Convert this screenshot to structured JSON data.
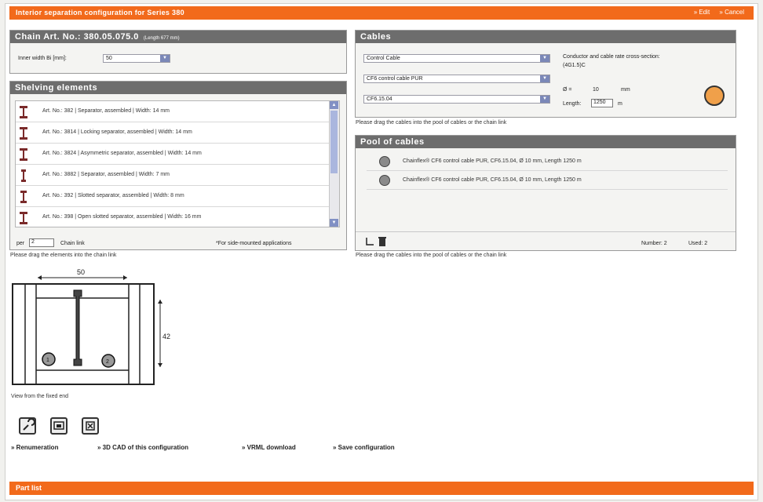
{
  "header": {
    "title": "Interior separation configuration for Series 380",
    "links": [
      "» Edit",
      "» Cancel"
    ]
  },
  "chain": {
    "title": "Chain Art. No.: 380.05.075.0",
    "subtitle": "(Length 677 mm)",
    "inner_width_label": "Inner width Bi [mm]:",
    "inner_width_value": "50"
  },
  "shelving": {
    "title": "Shelving elements",
    "items": [
      "Art. No.: 382  |  Separator, assembled  |  Width: 14 mm",
      "Art. No.: 3814  |  Locking separator, assembled  |  Width: 14 mm",
      "Art. No.: 3824  |  Asymmetric separator, assembled  |  Width: 14 mm",
      "Art. No.: 3882  |  Separator, assembled  |  Width: 7 mm",
      "Art. No.: 392  |  Slotted separator, assembled  |  Width: 8 mm",
      "Art. No.: 398  |  Open slotted separator, assembled  |  Width: 16 mm"
    ],
    "per_label": "per",
    "per_value": "2",
    "chain_link_label": "Chain link",
    "side_note": "*For side-mounted applications",
    "drag_note": "Please drag the elements into the chain link"
  },
  "cables": {
    "title": "Cables",
    "select1": "Control Cable",
    "select2": "CF6 control cable PUR",
    "select3": "CF6.15.04",
    "conductor_label": "Conductor and cable rate cross-section:",
    "conductor_value": "(4G1.5)C",
    "diameter_label": "Ø =",
    "diameter_value": "10",
    "diameter_unit": "mm",
    "length_label": "Length:",
    "length_value": "1250",
    "length_unit": "m",
    "drag_note": "Please drag the cables into the pool of cables or the chain link",
    "cable_color": "#f0a04a"
  },
  "pool": {
    "title": "Pool of cables",
    "items": [
      "Chainflex® CF6 control cable PUR, CF6.15.04, Ø 10 mm, Length 1250 m",
      "Chainflex® CF6 control cable PUR, CF6.15.04, Ø 10 mm, Length 1250 m"
    ],
    "number_label": "Number: 2",
    "used_label": "Used: 2",
    "drag_note": "Please drag the cables into the pool of cables or the chain link"
  },
  "drawing": {
    "width_dim": "50",
    "height_dim": "42",
    "cable1": "1",
    "cable2": "2",
    "caption": "View from the fixed end"
  },
  "actions": {
    "renumeration": "Renumeration",
    "cad": "3D CAD of this configuration",
    "vrml": "VRML download",
    "save": "Save configuration"
  },
  "partlist": {
    "title": "Part list"
  },
  "colors": {
    "accent": "#f26a1b",
    "panel_header": "#6d6d6d"
  }
}
